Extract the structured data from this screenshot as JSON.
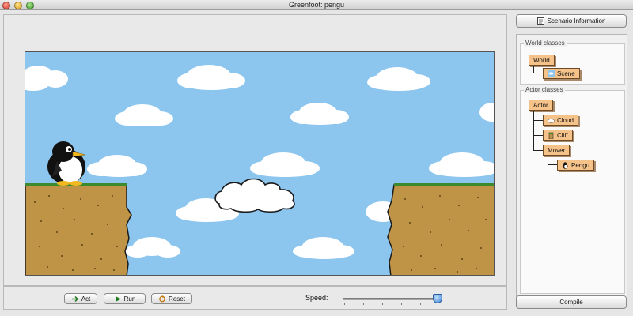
{
  "window": {
    "title": "Greenfoot: pengu"
  },
  "controls": {
    "act_label": "Act",
    "run_label": "Run",
    "reset_label": "Reset",
    "speed_label": "Speed:",
    "speed_value_fraction": 0.95
  },
  "sidebar": {
    "scenario_info_label": "Scenario Information",
    "world_classes_title": "World classes",
    "actor_classes_title": "Actor classes",
    "world_classes": [
      "World",
      "Scene"
    ],
    "actor_classes": [
      "Actor",
      "Cloud",
      "Cliff",
      "Mover",
      "Pengu"
    ],
    "compile_label": "Compile"
  },
  "colors": {
    "sky": "#8cc5ee",
    "class_box": "#f5c28a",
    "cliff": "#c09446",
    "grass": "#3c8a2e"
  },
  "icons": {
    "act": "step-arrow-icon",
    "run": "play-icon",
    "reset": "reset-icon",
    "scenario": "scenario-document-icon"
  }
}
